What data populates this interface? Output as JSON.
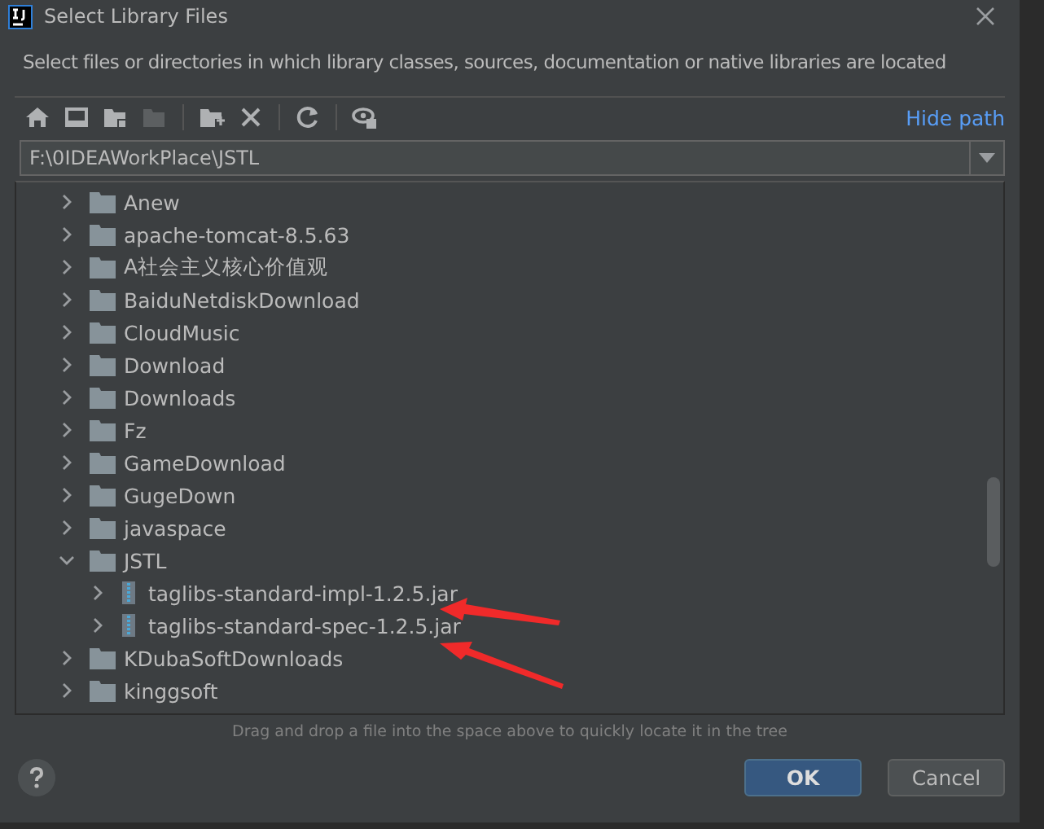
{
  "window": {
    "title": "Select Library Files"
  },
  "description": "Select files or directories in which library classes, sources, documentation or native libraries are located",
  "toolbar": {
    "hide_path_link": "Hide path"
  },
  "path_field": {
    "value": "F:\\0IDEAWorkPlace\\JSTL"
  },
  "tree": [
    {
      "label": "Anew",
      "kind": "folder",
      "expanded": false
    },
    {
      "label": "apache-tomcat-8.5.63",
      "kind": "folder",
      "expanded": false
    },
    {
      "label": "A社会主义核心价值观",
      "kind": "folder",
      "expanded": false
    },
    {
      "label": "BaiduNetdiskDownload",
      "kind": "folder",
      "expanded": false
    },
    {
      "label": "CloudMusic",
      "kind": "folder",
      "expanded": false
    },
    {
      "label": "Download",
      "kind": "folder",
      "expanded": false
    },
    {
      "label": "Downloads",
      "kind": "folder",
      "expanded": false
    },
    {
      "label": "Fz",
      "kind": "folder",
      "expanded": false
    },
    {
      "label": "GameDownload",
      "kind": "folder",
      "expanded": false
    },
    {
      "label": "GugeDown",
      "kind": "folder",
      "expanded": false
    },
    {
      "label": "javaspace",
      "kind": "folder",
      "expanded": false
    },
    {
      "label": "JSTL",
      "kind": "folder",
      "expanded": true,
      "children": [
        {
          "label": "taglibs-standard-impl-1.2.5.jar",
          "kind": "jar",
          "expanded": false
        },
        {
          "label": "taglibs-standard-spec-1.2.5.jar",
          "kind": "jar",
          "expanded": false
        }
      ]
    },
    {
      "label": "KDubaSoftDownloads",
      "kind": "folder",
      "expanded": false
    },
    {
      "label": "kinggsoft",
      "kind": "folder",
      "expanded": false
    }
  ],
  "hint": "Drag and drop a file into the space above to quickly locate it in the tree",
  "buttons": [
    {
      "label": "OK",
      "kind": "primary"
    },
    {
      "label": "Cancel",
      "kind": "secondary"
    }
  ]
}
